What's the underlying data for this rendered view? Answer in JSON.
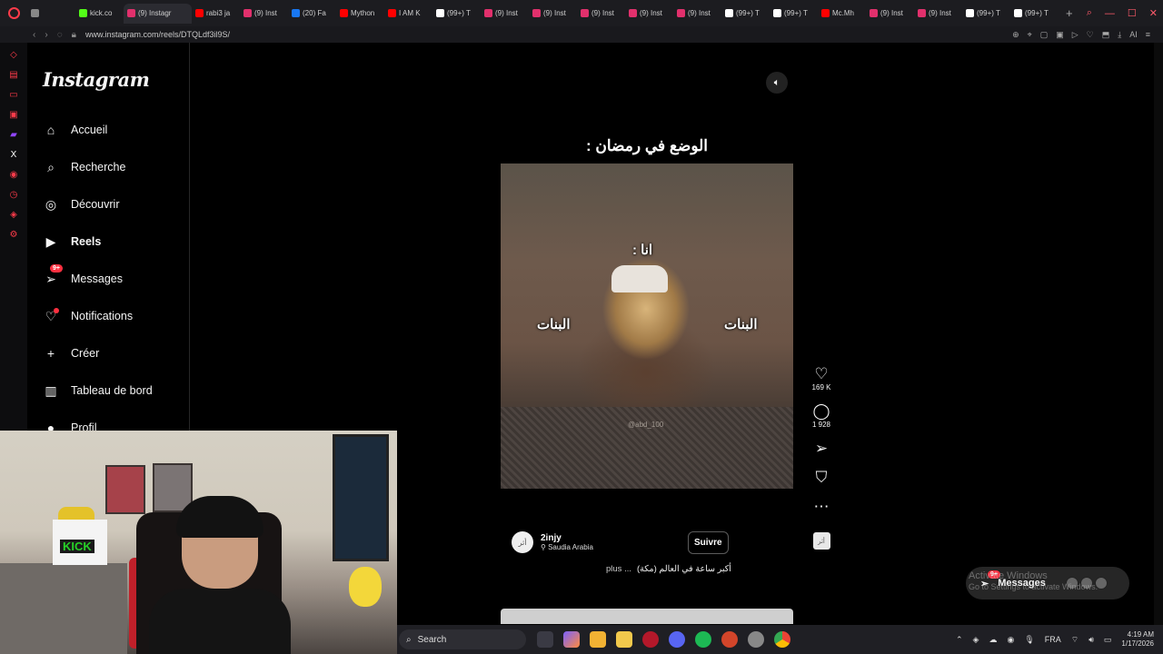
{
  "browser": {
    "tabs": [
      {
        "label": "",
        "color": "#888888"
      },
      {
        "label": "kick.co",
        "color": "#53fc18"
      },
      {
        "label": "(9) Instagr",
        "color": "#e1306c",
        "active": true
      },
      {
        "label": "rabi3 ja",
        "color": "#ff0000"
      },
      {
        "label": "(9) Inst",
        "color": "#e1306c"
      },
      {
        "label": "(20) Fa",
        "color": "#1877f2"
      },
      {
        "label": "Mython",
        "color": "#ff0000"
      },
      {
        "label": "I AM K",
        "color": "#ff0000"
      },
      {
        "label": "(99+) T",
        "color": "#ffffff"
      },
      {
        "label": "(9) Inst",
        "color": "#e1306c"
      },
      {
        "label": "(9) Inst",
        "color": "#e1306c"
      },
      {
        "label": "(9) Inst",
        "color": "#e1306c"
      },
      {
        "label": "(9) Inst",
        "color": "#e1306c"
      },
      {
        "label": "(9) Inst",
        "color": "#e1306c"
      },
      {
        "label": "(99+) T",
        "color": "#ffffff"
      },
      {
        "label": "(99+) T",
        "color": "#ffffff"
      },
      {
        "label": "Mc.Mh",
        "color": "#ff0000"
      },
      {
        "label": "(9) Inst",
        "color": "#e1306c"
      },
      {
        "label": "(9) Inst",
        "color": "#e1306c"
      },
      {
        "label": "(99+) T",
        "color": "#ffffff"
      },
      {
        "label": "(99+) T",
        "color": "#ffffff"
      }
    ],
    "new_tab": "+",
    "url": "www.instagram.com/reels/DTQLdf3il9S/"
  },
  "nav": {
    "logo": "Instagram",
    "items": [
      {
        "label": "Accueil",
        "icon": "home-icon",
        "glyph": "⌂"
      },
      {
        "label": "Recherche",
        "icon": "search-icon",
        "glyph": "⌕"
      },
      {
        "label": "Découvrir",
        "icon": "compass-icon",
        "glyph": "◎"
      },
      {
        "label": "Reels",
        "icon": "reels-icon",
        "glyph": "▶"
      },
      {
        "label": "Messages",
        "icon": "messenger-icon",
        "glyph": "➢",
        "badge": "9+"
      },
      {
        "label": "Notifications",
        "icon": "heart-icon",
        "glyph": "♡"
      },
      {
        "label": "Créer",
        "icon": "plus-icon",
        "glyph": "+"
      },
      {
        "label": "Tableau de bord",
        "icon": "dashboard-icon",
        "glyph": "▥"
      },
      {
        "label": "Profil",
        "icon": "profile-avatar-icon",
        "glyph": "●"
      }
    ]
  },
  "reel": {
    "top_caption": "الوضع في رمضان :",
    "label_me": "انا :",
    "label_girls_left": "البنات",
    "label_girls_right": "البنات",
    "watermark": "@abd_100",
    "author": {
      "name": "2injy",
      "location": "Saudia Arabia",
      "avatar": "أثر"
    },
    "follow": "Suivre",
    "description": "أكبر ساعة في العالم (مكة)",
    "more": "plus ...",
    "likes": "169 K",
    "comments": "1 928",
    "audio_thumb": "أثر"
  },
  "messages_pill": {
    "label": "Messages",
    "badge": "9+"
  },
  "activation": {
    "title": "Activate Windows",
    "subtitle": "Go to Settings to activate Windows."
  },
  "taskbar": {
    "search": "Search",
    "lang": "FRA",
    "time": "4:19 AM",
    "date": "1/17/2026"
  },
  "colors": {
    "accent": "#ff3040",
    "opera": "#ff3b4a",
    "bg": "#000000"
  }
}
